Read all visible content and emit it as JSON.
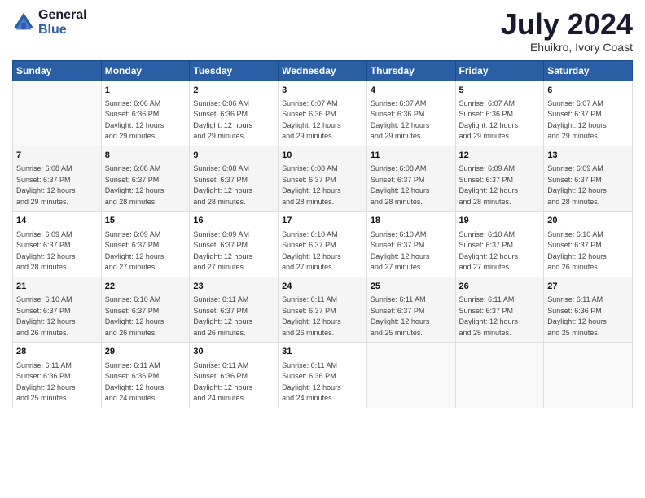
{
  "header": {
    "logo_line1": "General",
    "logo_line2": "Blue",
    "title": "July 2024",
    "subtitle": "Ehuikro, Ivory Coast"
  },
  "weekdays": [
    "Sunday",
    "Monday",
    "Tuesday",
    "Wednesday",
    "Thursday",
    "Friday",
    "Saturday"
  ],
  "weeks": [
    [
      {
        "day": "",
        "info": ""
      },
      {
        "day": "1",
        "info": "Sunrise: 6:06 AM\nSunset: 6:36 PM\nDaylight: 12 hours\nand 29 minutes."
      },
      {
        "day": "2",
        "info": "Sunrise: 6:06 AM\nSunset: 6:36 PM\nDaylight: 12 hours\nand 29 minutes."
      },
      {
        "day": "3",
        "info": "Sunrise: 6:07 AM\nSunset: 6:36 PM\nDaylight: 12 hours\nand 29 minutes."
      },
      {
        "day": "4",
        "info": "Sunrise: 6:07 AM\nSunset: 6:36 PM\nDaylight: 12 hours\nand 29 minutes."
      },
      {
        "day": "5",
        "info": "Sunrise: 6:07 AM\nSunset: 6:36 PM\nDaylight: 12 hours\nand 29 minutes."
      },
      {
        "day": "6",
        "info": "Sunrise: 6:07 AM\nSunset: 6:37 PM\nDaylight: 12 hours\nand 29 minutes."
      }
    ],
    [
      {
        "day": "7",
        "info": "Sunrise: 6:08 AM\nSunset: 6:37 PM\nDaylight: 12 hours\nand 29 minutes."
      },
      {
        "day": "8",
        "info": "Sunrise: 6:08 AM\nSunset: 6:37 PM\nDaylight: 12 hours\nand 28 minutes."
      },
      {
        "day": "9",
        "info": "Sunrise: 6:08 AM\nSunset: 6:37 PM\nDaylight: 12 hours\nand 28 minutes."
      },
      {
        "day": "10",
        "info": "Sunrise: 6:08 AM\nSunset: 6:37 PM\nDaylight: 12 hours\nand 28 minutes."
      },
      {
        "day": "11",
        "info": "Sunrise: 6:08 AM\nSunset: 6:37 PM\nDaylight: 12 hours\nand 28 minutes."
      },
      {
        "day": "12",
        "info": "Sunrise: 6:09 AM\nSunset: 6:37 PM\nDaylight: 12 hours\nand 28 minutes."
      },
      {
        "day": "13",
        "info": "Sunrise: 6:09 AM\nSunset: 6:37 PM\nDaylight: 12 hours\nand 28 minutes."
      }
    ],
    [
      {
        "day": "14",
        "info": "Sunrise: 6:09 AM\nSunset: 6:37 PM\nDaylight: 12 hours\nand 28 minutes."
      },
      {
        "day": "15",
        "info": "Sunrise: 6:09 AM\nSunset: 6:37 PM\nDaylight: 12 hours\nand 27 minutes."
      },
      {
        "day": "16",
        "info": "Sunrise: 6:09 AM\nSunset: 6:37 PM\nDaylight: 12 hours\nand 27 minutes."
      },
      {
        "day": "17",
        "info": "Sunrise: 6:10 AM\nSunset: 6:37 PM\nDaylight: 12 hours\nand 27 minutes."
      },
      {
        "day": "18",
        "info": "Sunrise: 6:10 AM\nSunset: 6:37 PM\nDaylight: 12 hours\nand 27 minutes."
      },
      {
        "day": "19",
        "info": "Sunrise: 6:10 AM\nSunset: 6:37 PM\nDaylight: 12 hours\nand 27 minutes."
      },
      {
        "day": "20",
        "info": "Sunrise: 6:10 AM\nSunset: 6:37 PM\nDaylight: 12 hours\nand 26 minutes."
      }
    ],
    [
      {
        "day": "21",
        "info": "Sunrise: 6:10 AM\nSunset: 6:37 PM\nDaylight: 12 hours\nand 26 minutes."
      },
      {
        "day": "22",
        "info": "Sunrise: 6:10 AM\nSunset: 6:37 PM\nDaylight: 12 hours\nand 26 minutes."
      },
      {
        "day": "23",
        "info": "Sunrise: 6:11 AM\nSunset: 6:37 PM\nDaylight: 12 hours\nand 26 minutes."
      },
      {
        "day": "24",
        "info": "Sunrise: 6:11 AM\nSunset: 6:37 PM\nDaylight: 12 hours\nand 26 minutes."
      },
      {
        "day": "25",
        "info": "Sunrise: 6:11 AM\nSunset: 6:37 PM\nDaylight: 12 hours\nand 25 minutes."
      },
      {
        "day": "26",
        "info": "Sunrise: 6:11 AM\nSunset: 6:37 PM\nDaylight: 12 hours\nand 25 minutes."
      },
      {
        "day": "27",
        "info": "Sunrise: 6:11 AM\nSunset: 6:36 PM\nDaylight: 12 hours\nand 25 minutes."
      }
    ],
    [
      {
        "day": "28",
        "info": "Sunrise: 6:11 AM\nSunset: 6:36 PM\nDaylight: 12 hours\nand 25 minutes."
      },
      {
        "day": "29",
        "info": "Sunrise: 6:11 AM\nSunset: 6:36 PM\nDaylight: 12 hours\nand 24 minutes."
      },
      {
        "day": "30",
        "info": "Sunrise: 6:11 AM\nSunset: 6:36 PM\nDaylight: 12 hours\nand 24 minutes."
      },
      {
        "day": "31",
        "info": "Sunrise: 6:11 AM\nSunset: 6:36 PM\nDaylight: 12 hours\nand 24 minutes."
      },
      {
        "day": "",
        "info": ""
      },
      {
        "day": "",
        "info": ""
      },
      {
        "day": "",
        "info": ""
      }
    ]
  ]
}
